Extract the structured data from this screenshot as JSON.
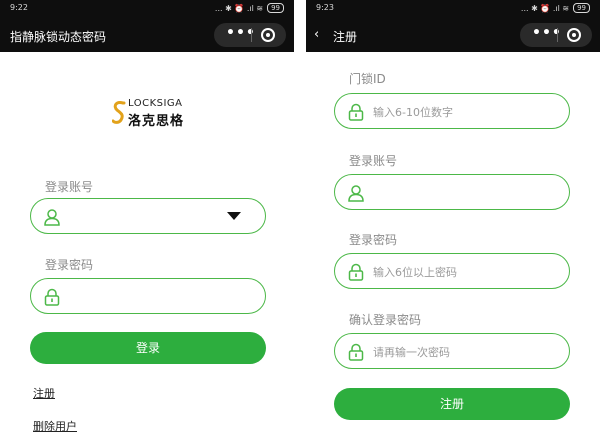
{
  "left": {
    "status_time": "9:22",
    "status_icons": "... ✱ ⏰ .ıl ≋",
    "battery": "99",
    "nav_title": "指静脉锁动态密码",
    "logo_top": "LOCKSIGA",
    "logo_bottom": "洛克思格",
    "account_label": "登录账号",
    "password_label": "登录密码",
    "login_button": "登录",
    "register_link": "注册",
    "delete_user_link": "删除用户"
  },
  "right": {
    "status_time": "9:23",
    "status_icons": "... ✱ ⏰ .ıl ≋",
    "battery": "99",
    "back_glyph": "‹",
    "nav_title": "注册",
    "lock_id_label": "门锁ID",
    "lock_id_placeholder": "输入6-10位数字",
    "account_label": "登录账号",
    "password_label": "登录密码",
    "password_placeholder": "输入6位以上密码",
    "confirm_label": "确认登录密码",
    "confirm_placeholder": "请再输一次密码",
    "register_button": "注册"
  },
  "colors": {
    "accent_green": "#2dae3e",
    "field_border": "#4cb848",
    "logo_gold": "#e2a21b"
  }
}
